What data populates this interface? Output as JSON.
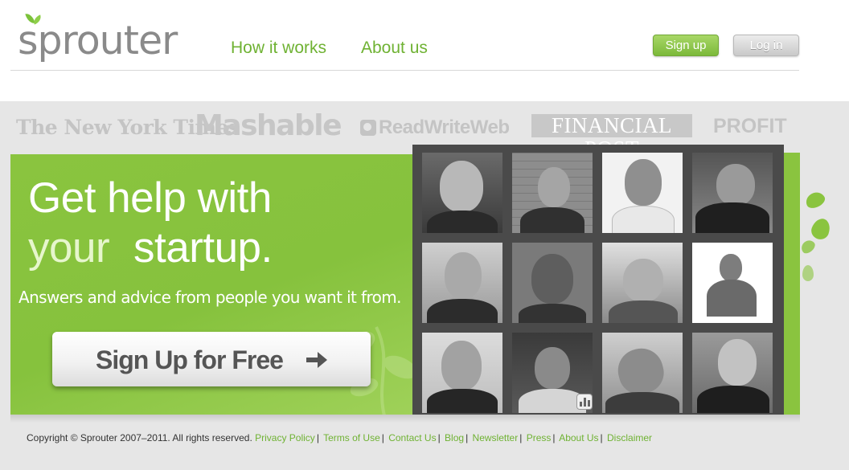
{
  "brand": {
    "name": "sprouter"
  },
  "nav": {
    "how_it_works": "How it works",
    "about_us": "About us",
    "sign_up": "Sign up",
    "log_in": "Log in"
  },
  "press": {
    "nyt": "The New York Times",
    "mashable": "Mashable",
    "readwriteweb": "ReadWriteWeb",
    "financial_post": "FINANCIAL POST",
    "profit": "PROFIT"
  },
  "hero": {
    "title_line1": "Get help with",
    "title_line2_a": "your",
    "title_line2_b": "startup.",
    "subtitle": "Answers and advice from people you want it from.",
    "cta_label": "Sign Up for Free"
  },
  "colors": {
    "accent": "#8ac43f",
    "link": "#6fb233"
  },
  "footer": {
    "copyright": "Copyright © Sprouter 2007–2011. All rights reserved.",
    "links": [
      "Privacy Policy",
      "Terms of Use",
      "Contact Us",
      "Blog",
      "Newsletter",
      "Press",
      "About Us",
      "Disclaimer"
    ]
  }
}
